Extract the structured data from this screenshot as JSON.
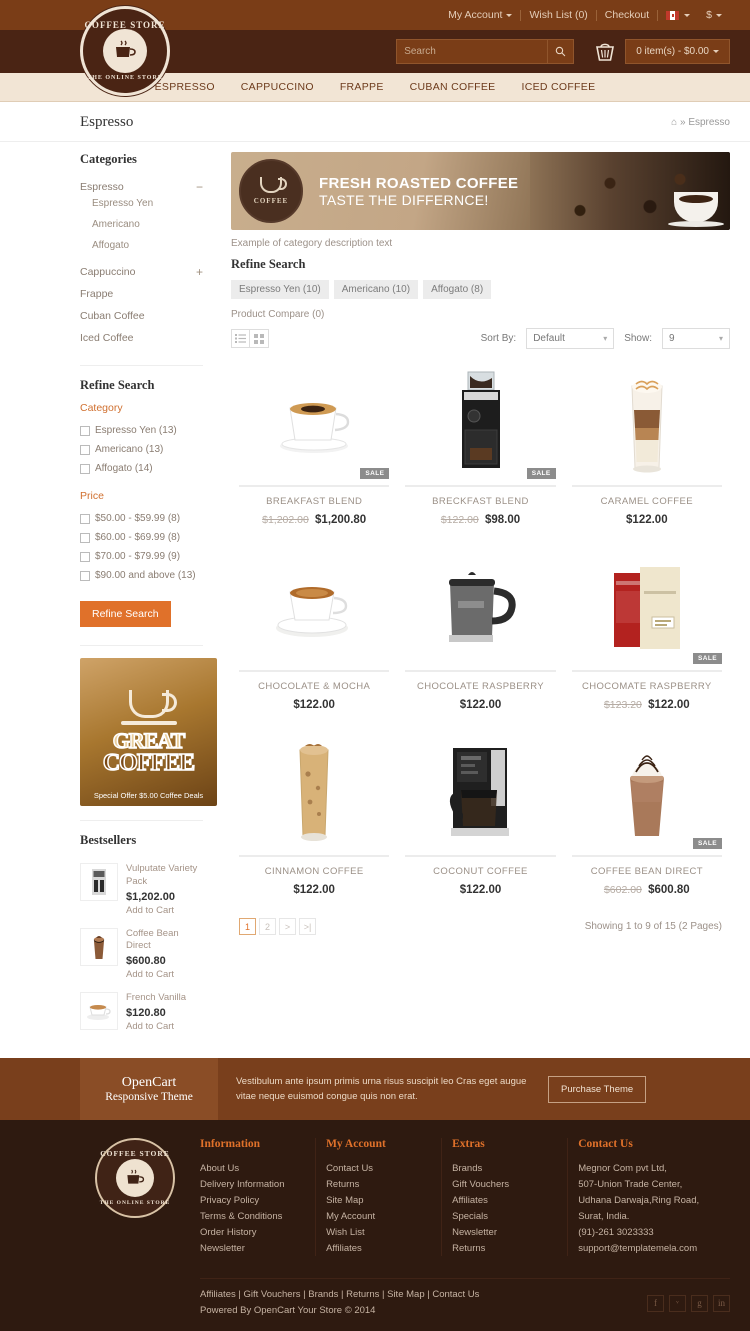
{
  "topbar": {
    "my_account": "My Account",
    "wish_list": "Wish List (0)",
    "checkout": "Checkout",
    "currency": "$",
    "flag_icon": "flag-icon"
  },
  "header": {
    "search_placeholder": "Search",
    "search_value": "",
    "cart_text": "0 item(s) - $0.00",
    "logo_top": "COFFEE STORE",
    "logo_bottom": "THE ONLINE STORE"
  },
  "nav": {
    "items": [
      {
        "label": "ESPRESSO"
      },
      {
        "label": "CAPPUCCINO"
      },
      {
        "label": "FRAPPE"
      },
      {
        "label": "CUBAN COFFEE"
      },
      {
        "label": "ICED COFFEE"
      }
    ]
  },
  "page": {
    "title": "Espresso",
    "breadcrumb_home": "⌂",
    "breadcrumb_sep": "»",
    "breadcrumb_current": "Espresso"
  },
  "sidebar": {
    "categories_heading": "Categories",
    "categories": [
      {
        "label": "Espresso",
        "toggle": "−",
        "children": [
          {
            "label": "Espresso Yen"
          },
          {
            "label": "Americano"
          },
          {
            "label": "Affogato"
          }
        ]
      },
      {
        "label": "Cappuccino",
        "toggle": "+",
        "children": []
      },
      {
        "label": "Frappe",
        "toggle": "",
        "children": []
      },
      {
        "label": "Cuban Coffee",
        "toggle": "",
        "children": []
      },
      {
        "label": "Iced Coffee",
        "toggle": "",
        "children": []
      }
    ],
    "refine_heading": "Refine Search",
    "category_group_label": "Category",
    "category_filters": [
      {
        "label": "Espresso Yen (13)"
      },
      {
        "label": "Americano (13)"
      },
      {
        "label": "Affogato (14)"
      }
    ],
    "price_group_label": "Price",
    "price_filters": [
      {
        "label": "$50.00 - $59.99 (8)"
      },
      {
        "label": "$60.00 - $69.99 (8)"
      },
      {
        "label": "$70.00 - $79.99 (9)"
      },
      {
        "label": "$90.00 and above (13)"
      }
    ],
    "refine_button": "Refine Search",
    "ad": {
      "word1": "GREAT",
      "word2": "COFFEE",
      "subtitle": "Special Offer $5.00 Coffee Deals"
    },
    "bestsellers_heading": "Bestsellers",
    "bestsellers": [
      {
        "name": "Vulputate Variety Pack",
        "price": "$1,202.00",
        "cart": "Add to Cart"
      },
      {
        "name": "Coffee Bean Direct",
        "price": "$600.80",
        "cart": "Add to Cart"
      },
      {
        "name": "French Vanilla",
        "price": "$120.80",
        "cart": "Add to Cart"
      }
    ]
  },
  "content": {
    "banner": {
      "badge_word": "COFFEE",
      "line1": "FRESH ROASTED COFFEE",
      "line2": "TASTE  THE DIFFERNCE!"
    },
    "description": "Example of category description text",
    "refine_heading": "Refine Search",
    "refine_tags": [
      {
        "label": "Espresso Yen (10)"
      },
      {
        "label": "Americano (10)"
      },
      {
        "label": "Affogato (8)"
      }
    ],
    "product_compare": "Product Compare (0)",
    "toolbar": {
      "sort_label": "Sort By:",
      "sort_value": "Default",
      "show_label": "Show:",
      "show_value": "9",
      "list_view_icon": "list-view-icon",
      "grid_view_icon": "grid-view-icon"
    },
    "products": [
      {
        "name": "BREAKFAST BLEND",
        "old_price": "$1,202.00",
        "price": "$1,200.80",
        "sale": "SALE",
        "art": "cup-black-coffee"
      },
      {
        "name": "BRECKFAST BLEND",
        "old_price": "$122.00",
        "price": "$98.00",
        "sale": "SALE",
        "art": "grinder"
      },
      {
        "name": "CARAMEL COFFEE",
        "old_price": "",
        "price": "$122.00",
        "sale": "",
        "art": "latte-glass"
      },
      {
        "name": "CHOCOLATE & MOCHA",
        "old_price": "",
        "price": "$122.00",
        "sale": "",
        "art": "espresso-cup"
      },
      {
        "name": "CHOCOLATE RASPBERRY",
        "old_price": "",
        "price": "$122.00",
        "sale": "",
        "art": "travel-mug"
      },
      {
        "name": "CHOCOMATE RASPBERRY",
        "old_price": "$123.20",
        "price": "$122.00",
        "sale": "SALE",
        "art": "coffee-bags"
      },
      {
        "name": "CINNAMON COFFEE",
        "old_price": "",
        "price": "$122.00",
        "sale": "",
        "art": "iced-coffee-glass"
      },
      {
        "name": "COCONUT COFFEE",
        "old_price": "",
        "price": "$122.00",
        "sale": "",
        "art": "coffee-maker"
      },
      {
        "name": "COFFEE BEAN DIRECT",
        "old_price": "$602.00",
        "price": "$600.80",
        "sale": "SALE",
        "art": "frappe-cup"
      }
    ],
    "pagination": [
      {
        "label": "1",
        "active": true
      },
      {
        "label": "2",
        "active": false
      },
      {
        "label": ">",
        "active": false
      },
      {
        "label": ">|",
        "active": false
      }
    ],
    "showing": "Showing 1 to 9 of 15 (2 Pages)"
  },
  "promo": {
    "brand_line1": "OpenCart",
    "brand_line2": "Responsive Theme",
    "text": "Vestibulum ante ipsum primis urna risus suscipit leo Cras eget augue vitae neque euismod congue quis non erat.",
    "button": "Purchase Theme"
  },
  "footer": {
    "logo_top": "COFFEE STORE",
    "logo_bottom": "THE ONLINE STORE",
    "columns": [
      {
        "heading": "Information",
        "links": [
          {
            "label": "About Us"
          },
          {
            "label": "Delivery Information"
          },
          {
            "label": "Privacy Policy"
          },
          {
            "label": "Terms & Conditions"
          },
          {
            "label": "Order History"
          },
          {
            "label": "Newsletter"
          }
        ]
      },
      {
        "heading": "My Account",
        "links": [
          {
            "label": "Contact Us"
          },
          {
            "label": "Returns"
          },
          {
            "label": "Site Map"
          },
          {
            "label": "My Account"
          },
          {
            "label": "Wish List"
          },
          {
            "label": "Affiliates"
          }
        ]
      },
      {
        "heading": "Extras",
        "links": [
          {
            "label": "Brands"
          },
          {
            "label": "Gift Vouchers"
          },
          {
            "label": "Affiliates"
          },
          {
            "label": "Specials"
          },
          {
            "label": "Newsletter"
          },
          {
            "label": "Returns"
          }
        ]
      },
      {
        "heading": "Contact Us",
        "links": [
          {
            "label": "Megnor Com pvt Ltd,"
          },
          {
            "label": "507-Union Trade Center,"
          },
          {
            "label": "Udhana Darwaja,Ring Road,"
          },
          {
            "label": "Surat, India."
          },
          {
            "label": "(91)-261 3023333"
          },
          {
            "label": "support@templatemela.com"
          }
        ]
      }
    ],
    "bottom_links": "Affiliates | Gift Vouchers | Brands | Returns | Site Map | Contact Us",
    "copyright": "Powered By OpenCart Your Store © 2014",
    "social": [
      {
        "glyph": "f",
        "name": "facebook-icon"
      },
      {
        "glyph": "ᵛ",
        "name": "twitter-icon"
      },
      {
        "glyph": "g",
        "name": "google-plus-icon"
      },
      {
        "glyph": "in",
        "name": "linkedin-icon"
      }
    ]
  },
  "colors": {
    "accent": "#e0712a",
    "dark_brown": "#4a2414",
    "mid_brown": "#7a3d17",
    "cream": "#f2e5d5"
  }
}
